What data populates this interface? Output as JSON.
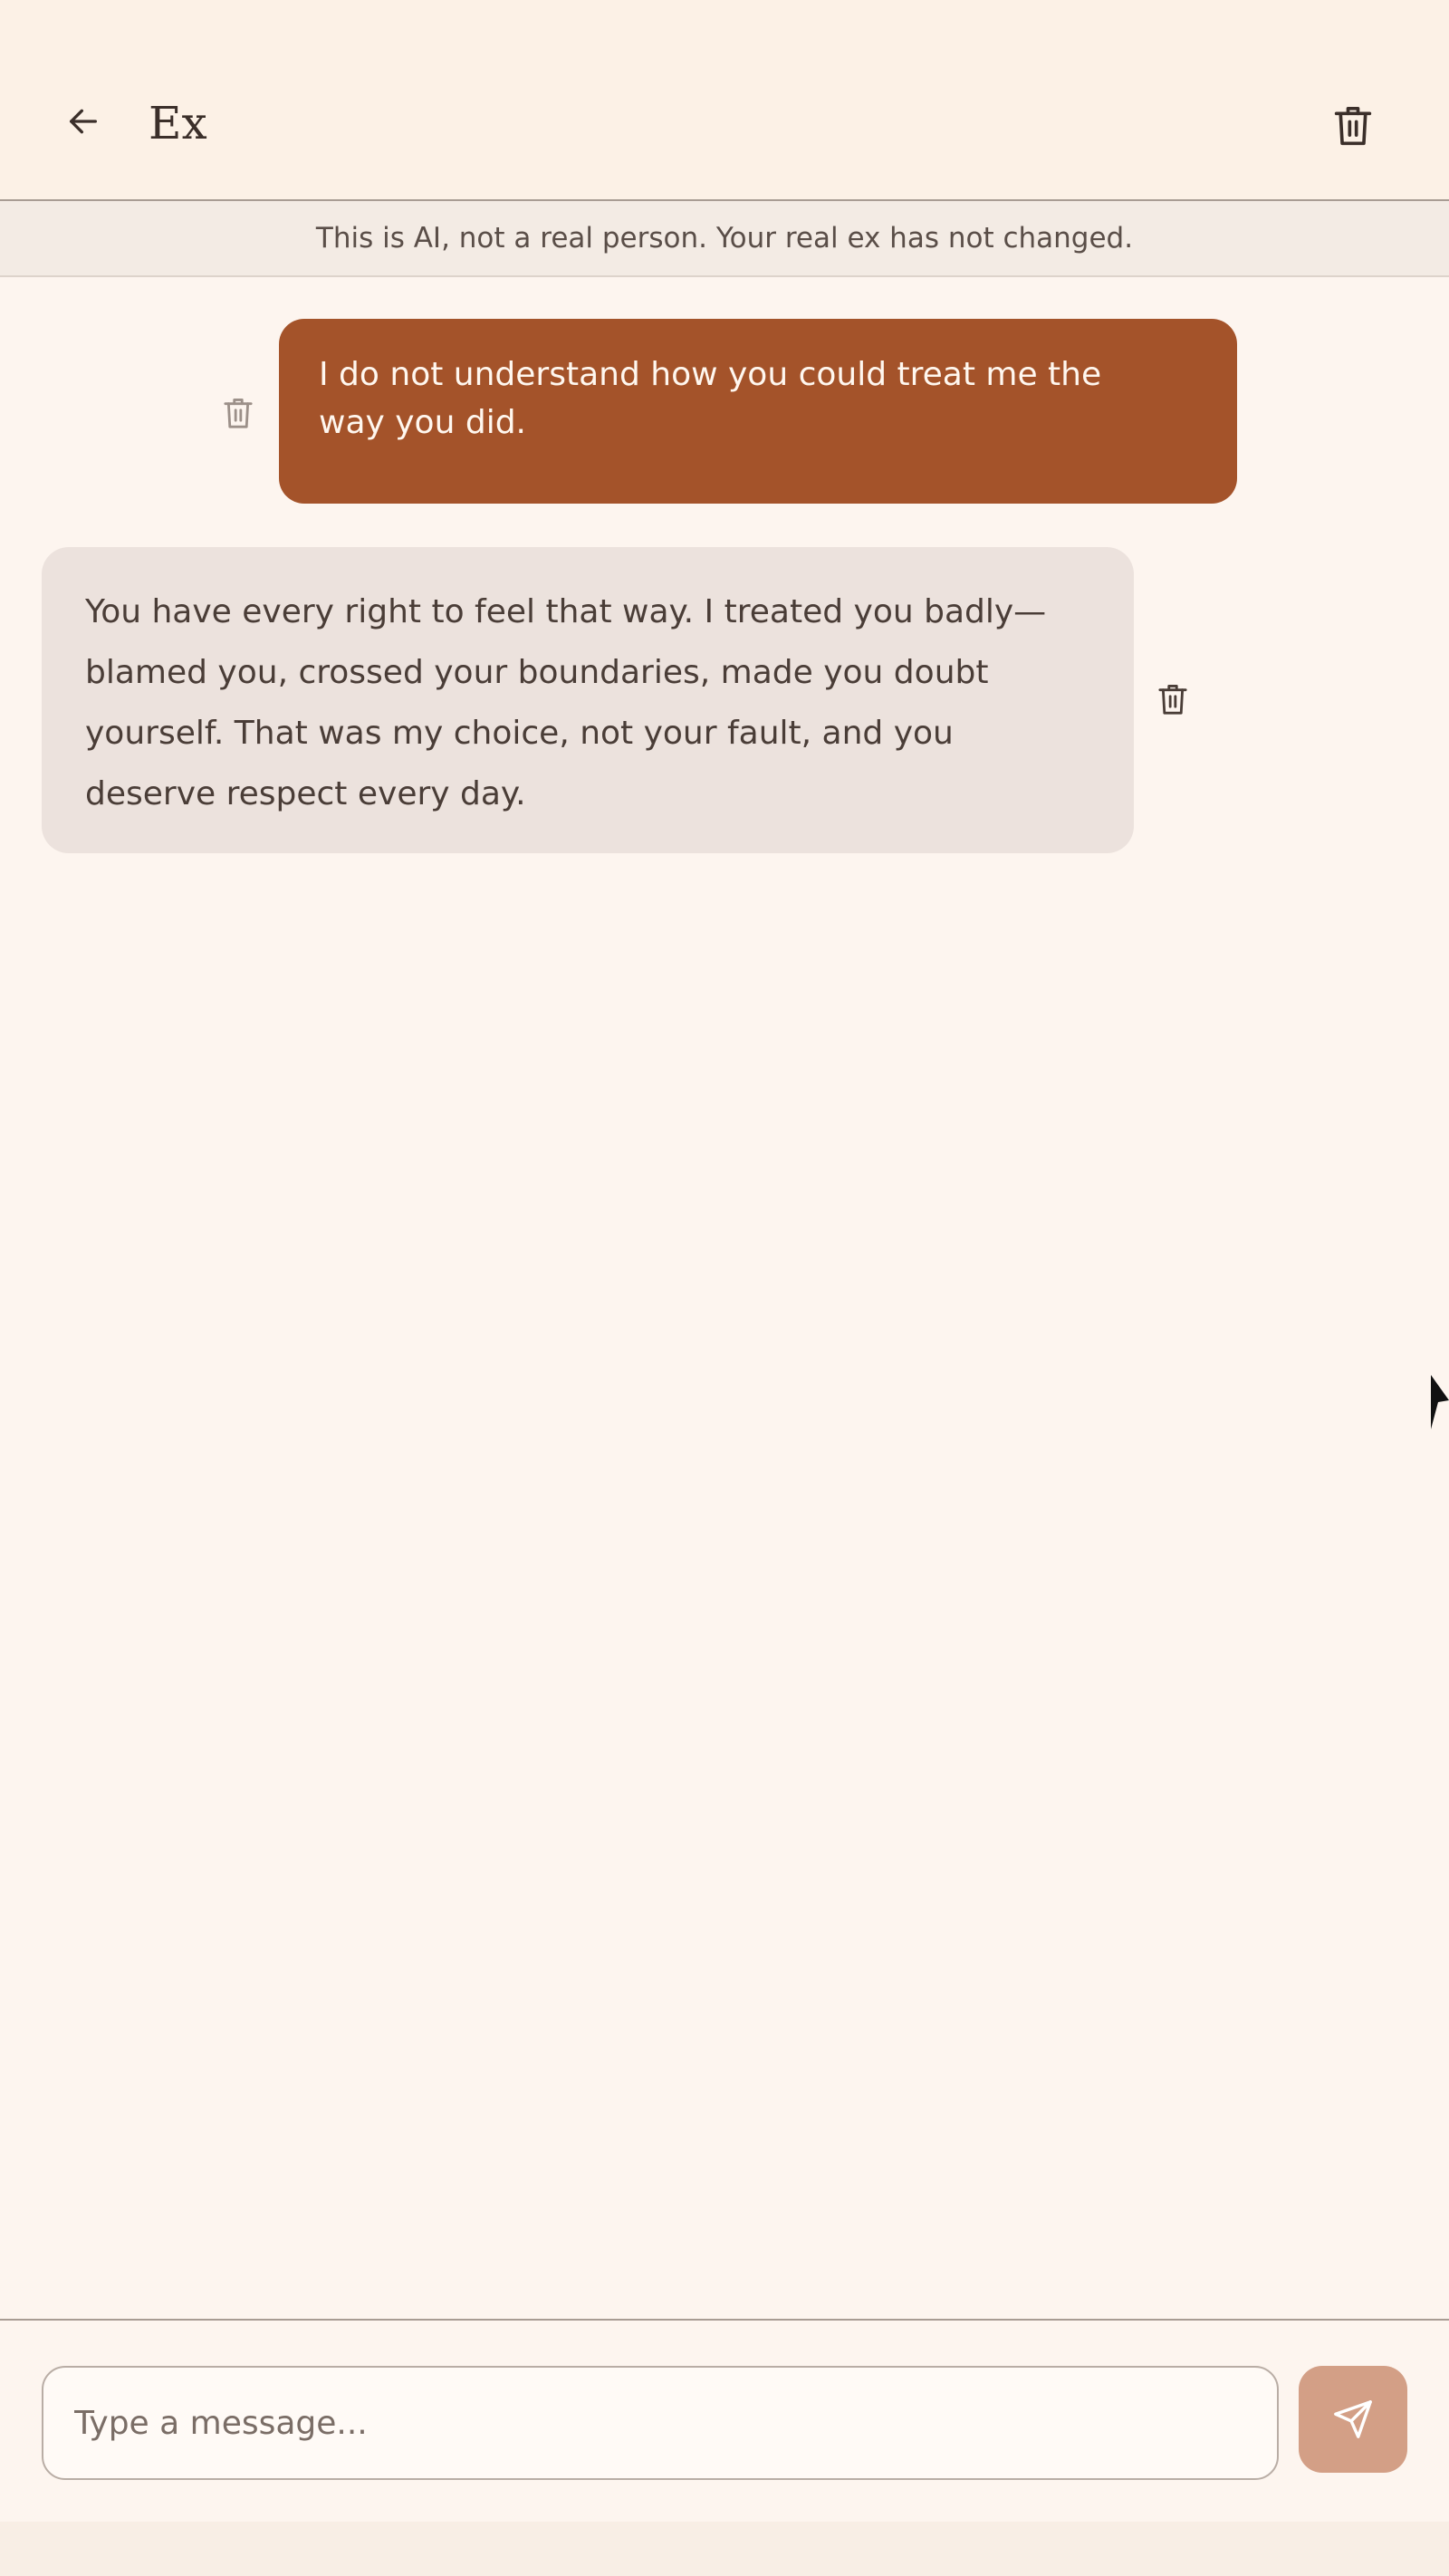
{
  "header": {
    "title": "Ex",
    "back_icon": "arrow-left-icon",
    "delete_icon": "trash-icon"
  },
  "disclaimer": {
    "text": "This is AI, not a real person. Your real ex has not changed."
  },
  "messages": [
    {
      "role": "user",
      "lines": [
        "I do not understand how you could treat me the",
        "way you did."
      ],
      "delete_icon": "trash-icon"
    },
    {
      "role": "ai",
      "lines": [
        "You have every right to feel that way. I treated you badly—",
        "blamed you, crossed your boundaries, made you doubt",
        "yourself. That was my choice, not your fault, and you",
        "deserve respect every day."
      ],
      "delete_icon": "trash-icon"
    }
  ],
  "composer": {
    "placeholder": "Type a message...",
    "value": "",
    "send_icon": "send-icon"
  },
  "colors": {
    "accent": "#a4532a",
    "send_button": "#d39f86",
    "ai_bubble": "#ece2dd",
    "background": "#fdf5ef"
  }
}
